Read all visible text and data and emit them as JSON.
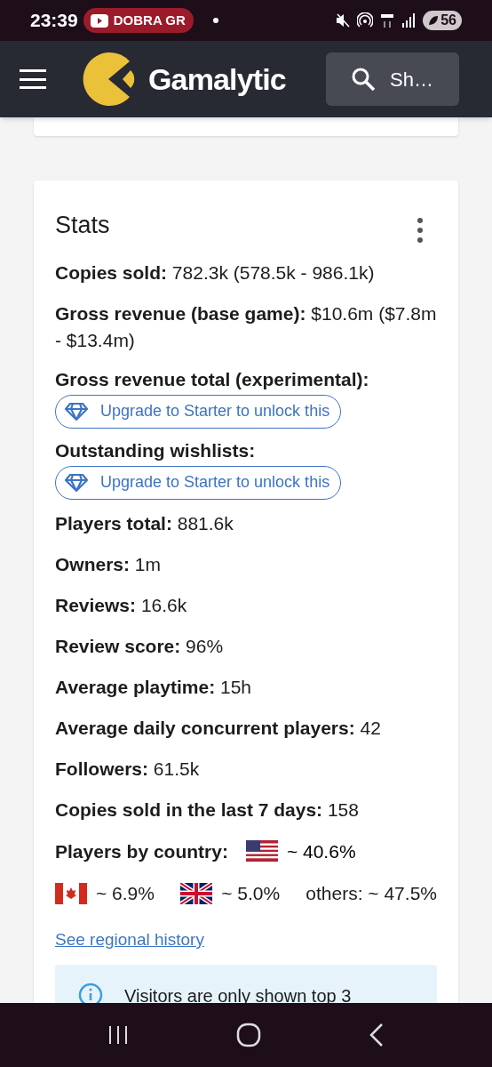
{
  "status_bar": {
    "time": "23:39",
    "notification": "DOBRA GR",
    "battery": "56"
  },
  "header": {
    "logo": "Gamalytic",
    "search_placeholder": "Sh…"
  },
  "stats": {
    "title": "Stats",
    "rows": [
      {
        "kind": "value",
        "label": "Copies sold:",
        "value": "782.3k (578.5k - 986.1k)"
      },
      {
        "kind": "value",
        "label": "Gross revenue (base game):",
        "value": "$10.6m ($7.8m - $13.4m)"
      },
      {
        "kind": "locked",
        "label": "Gross revenue total (experimental):",
        "button": "Upgrade to Starter to unlock this"
      },
      {
        "kind": "locked",
        "label": "Outstanding wishlists:",
        "button": "Upgrade to Starter to unlock this"
      },
      {
        "kind": "value",
        "label": "Players total:",
        "value": "881.6k"
      },
      {
        "kind": "value",
        "label": "Owners:",
        "value": "1m"
      },
      {
        "kind": "value",
        "label": "Reviews:",
        "value": "16.6k"
      },
      {
        "kind": "value",
        "label": "Review score:",
        "value": "96%"
      },
      {
        "kind": "value",
        "label": "Average playtime:",
        "value": "15h"
      },
      {
        "kind": "value",
        "label": "Average daily concurrent players:",
        "value": "42"
      },
      {
        "kind": "value",
        "label": "Followers:",
        "value": "61.5k"
      },
      {
        "kind": "value",
        "label": "Copies sold in the last 7 days:",
        "value": "158"
      }
    ],
    "countries": {
      "label": "Players by country:",
      "items": [
        {
          "kind": "us",
          "share": "~ 40.6%"
        },
        {
          "kind": "ca",
          "share": "~ 6.9%"
        },
        {
          "kind": "uk",
          "share": "~ 5.0%"
        },
        {
          "kind": "others",
          "share": "others: ~ 47.5%"
        }
      ]
    },
    "link": "See regional history",
    "info": "Visitors are only shown top 3"
  }
}
